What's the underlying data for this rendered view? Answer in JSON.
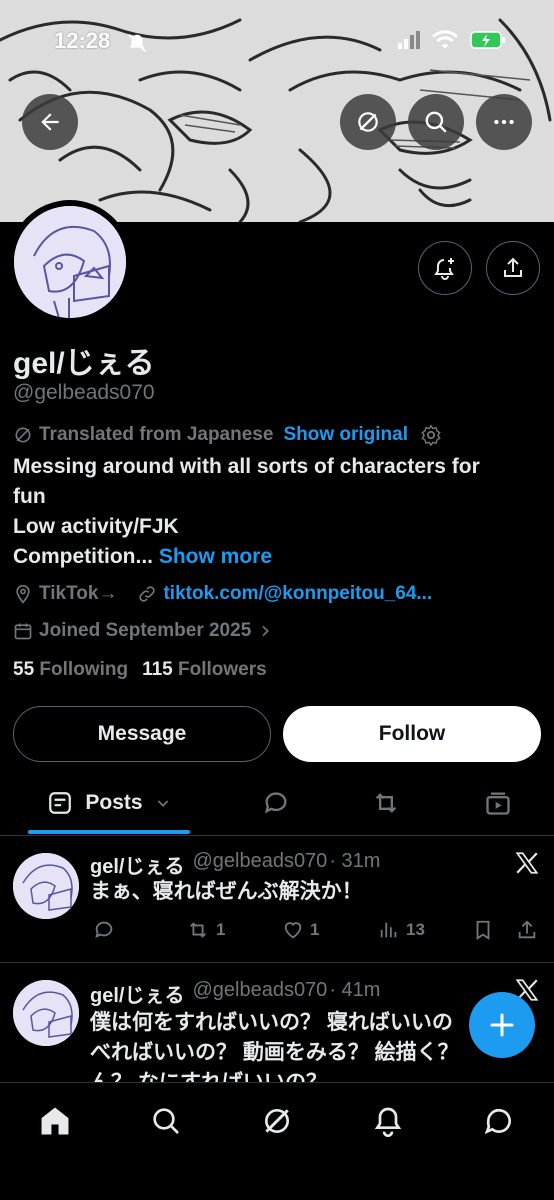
{
  "status": {
    "time": "12:28"
  },
  "profile": {
    "name": "gel/じぇる",
    "handle": "@gelbeads070",
    "translated_label": "Translated from Japanese",
    "show_original": "Show original",
    "bio_line1": "Messing around with all sorts of characters for",
    "bio_line2": "fun",
    "bio_line3": "Low activity/FJK",
    "bio_line4": "Competition...",
    "show_more": "Show more",
    "tiktok_label": "TikTok→",
    "link": "tiktok.com/@konnpeitou_64...",
    "joined": "Joined September 2025",
    "following_count": "55",
    "following_label": "Following",
    "followers_count": "115",
    "followers_label": "Followers"
  },
  "buttons": {
    "message": "Message",
    "follow": "Follow"
  },
  "tabs": {
    "posts": "Posts"
  },
  "posts": [
    {
      "name": "gel/じぇる",
      "handle": "@gelbeads070",
      "time": "· 31m",
      "text": "まぁ、寝ればぜんぶ解決か！",
      "retweets": "1",
      "likes": "1",
      "views": "13"
    },
    {
      "name": "gel/じぇる",
      "handle": "@gelbeads070",
      "time": "· 41m",
      "text_line1": "僕は何をすればいいの？ 寝ればいいの",
      "text_line2": "べればいいの？ 動画をみる？ 絵描く？",
      "text_line3": "ん？ なにすればいいの？"
    }
  ],
  "colors": {
    "accent": "#1d9bf0",
    "background": "#000000",
    "muted": "#71767b"
  }
}
